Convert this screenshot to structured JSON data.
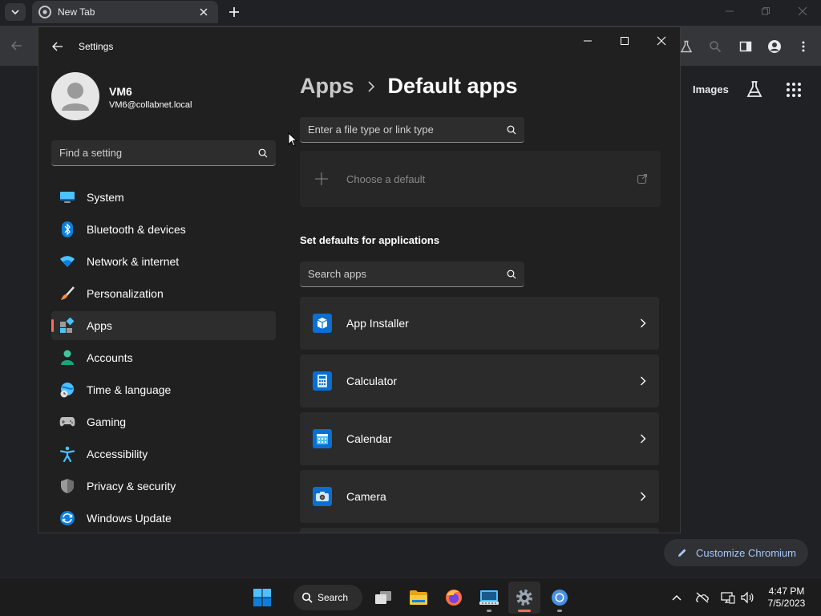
{
  "chrome": {
    "tab_title": "New Tab",
    "images_link": "Images",
    "customize_label": "Customize Chromium"
  },
  "settings": {
    "window_title": "Settings",
    "user": {
      "name": "VM6",
      "email": "VM6@collabnet.local"
    },
    "find_placeholder": "Find a setting",
    "nav": [
      {
        "label": "System",
        "icon": "monitor-icon"
      },
      {
        "label": "Bluetooth & devices",
        "icon": "bluetooth-icon"
      },
      {
        "label": "Network & internet",
        "icon": "wifi-icon"
      },
      {
        "label": "Personalization",
        "icon": "brush-icon"
      },
      {
        "label": "Apps",
        "icon": "apps-icon",
        "active": true
      },
      {
        "label": "Accounts",
        "icon": "person-icon"
      },
      {
        "label": "Time & language",
        "icon": "globe-clock-icon"
      },
      {
        "label": "Gaming",
        "icon": "gamepad-icon"
      },
      {
        "label": "Accessibility",
        "icon": "accessibility-icon"
      },
      {
        "label": "Privacy & security",
        "icon": "shield-icon"
      },
      {
        "label": "Windows Update",
        "icon": "sync-icon"
      }
    ],
    "breadcrumb": {
      "parent": "Apps",
      "current": "Default apps"
    },
    "file_type_placeholder": "Enter a file type or link type",
    "choose_default_label": "Choose a default",
    "defaults_heading": "Set defaults for applications",
    "app_search_placeholder": "Search apps",
    "apps": [
      {
        "name": "App Installer",
        "icon": "package-icon"
      },
      {
        "name": "Calculator",
        "icon": "calculator-icon"
      },
      {
        "name": "Calendar",
        "icon": "calendar-icon"
      },
      {
        "name": "Camera",
        "icon": "camera-icon"
      }
    ]
  },
  "taskbar": {
    "search_label": "Search",
    "time": "4:47 PM",
    "date": "7/5/2023"
  },
  "colors": {
    "accent": "#ff6a5c",
    "link_blue": "#a8c7fa",
    "app_icon_blue": "#0a6fd1"
  }
}
